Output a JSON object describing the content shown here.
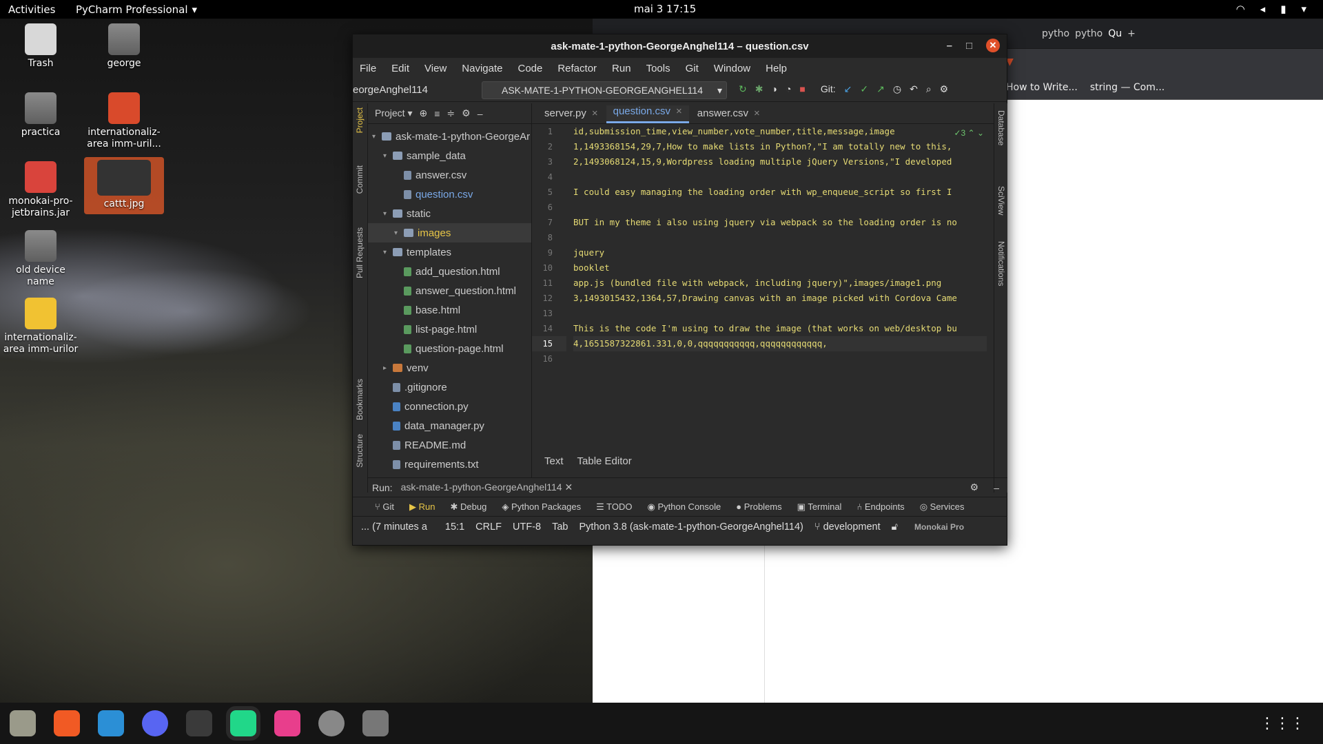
{
  "topbar": {
    "activities": "Activities",
    "app": "PyCharm Professional",
    "clock": "mai 3  17:15"
  },
  "desktop": {
    "icons": [
      "Trash",
      "george",
      "practica",
      "internationaliz-area imm-uril...",
      "monokai-pro-jetbrains.jar",
      "cattt.jpg",
      "old device name",
      "internationaliz-area imm-urilor"
    ]
  },
  "browser": {
    "tabs": [
      "pytho",
      "pytho",
      "Qu"
    ],
    "bookmarks": [
      "How to Write...",
      "string — Com..."
    ]
  },
  "ide": {
    "title": "ask-mate-1-python-GeorgeAnghel114 – question.csv",
    "menu": [
      "File",
      "Edit",
      "View",
      "Navigate",
      "Code",
      "Refactor",
      "Run",
      "Tools",
      "Git",
      "Window",
      "Help"
    ],
    "nav_project": "eorgeAnghel114",
    "run_config": "ASK-MATE-1-PYTHON-GEORGEANGHEL114",
    "git_label": "Git:",
    "project_header": "Project",
    "tree": [
      {
        "label": "ask-mate-1-python-GeorgeAr",
        "indent": 0,
        "type": "fold"
      },
      {
        "label": "sample_data",
        "indent": 1,
        "type": "fold"
      },
      {
        "label": "answer.csv",
        "indent": 2,
        "type": "file"
      },
      {
        "label": "question.csv",
        "indent": 2,
        "type": "file",
        "cls": "blue"
      },
      {
        "label": "static",
        "indent": 1,
        "type": "fold"
      },
      {
        "label": "images",
        "indent": 2,
        "type": "fold",
        "cls": "yellow",
        "sel": true
      },
      {
        "label": "templates",
        "indent": 1,
        "type": "fold"
      },
      {
        "label": "add_question.html",
        "indent": 2,
        "type": "html"
      },
      {
        "label": "answer_question.html",
        "indent": 2,
        "type": "html"
      },
      {
        "label": "base.html",
        "indent": 2,
        "type": "html"
      },
      {
        "label": "list-page.html",
        "indent": 2,
        "type": "html"
      },
      {
        "label": "question-page.html",
        "indent": 2,
        "type": "html"
      },
      {
        "label": "venv",
        "indent": 1,
        "type": "venv"
      },
      {
        "label": ".gitignore",
        "indent": 1,
        "type": "file"
      },
      {
        "label": "connection.py",
        "indent": 1,
        "type": "py"
      },
      {
        "label": "data_manager.py",
        "indent": 1,
        "type": "py"
      },
      {
        "label": "README.md",
        "indent": 1,
        "type": "file"
      },
      {
        "label": "requirements.txt",
        "indent": 1,
        "type": "file"
      },
      {
        "label": "server.py",
        "indent": 1,
        "type": "py"
      }
    ],
    "tabs": [
      {
        "label": "server.py",
        "active": false
      },
      {
        "label": "question.csv",
        "active": true
      },
      {
        "label": "answer.csv",
        "active": false
      }
    ],
    "code_lines": [
      "id,submission_time,view_number,vote_number,title,message,image",
      "1,1493368154,29,7,How to make lists in Python?,\"I am totally new to this,",
      "2,1493068124,15,9,Wordpress loading multiple jQuery Versions,\"I developed",
      "",
      "I could easy managing the loading order with wp_enqueue_script so first I",
      "",
      "BUT in my theme i also using jquery via webpack so the loading order is no",
      "",
      "jquery",
      "booklet",
      "app.js (bundled file with webpack, including jquery)\",images/image1.png",
      "3,1493015432,1364,57,Drawing canvas with an image picked with Cordova Came",
      "",
      "This is the code I'm using to draw the image (that works on web/desktop bu",
      "4,1651587322861.331,0,0,qqqqqqqqqqq,qqqqqqqqqqqq,",
      ""
    ],
    "current_line": "15",
    "inspection_count": "3",
    "editor_bottom_tabs": [
      "Text",
      "Table Editor"
    ],
    "run": {
      "label": "Run:",
      "config": "ask-mate-1-python-GeorgeAnghel114"
    },
    "tool_windows": [
      "Git",
      "Run",
      "Debug",
      "Python Packages",
      "TODO",
      "Python Console",
      "Problems",
      "Terminal",
      "Endpoints",
      "Services"
    ],
    "status": {
      "vcs": "... (7 minutes a",
      "pos": "15:1",
      "eol": "CRLF",
      "enc": "UTF-8",
      "indent": "Tab",
      "interpreter": "Python 3.8 (ask-mate-1-python-GeorgeAnghel114)",
      "branch": "development",
      "theme": "Monokai Pro"
    },
    "left_tool_tabs": [
      "Project",
      "Commit",
      "Pull Requests",
      "Bookmarks",
      "Structure"
    ],
    "right_tool_tabs": [
      "Database",
      "SciView",
      "Notifications"
    ]
  }
}
